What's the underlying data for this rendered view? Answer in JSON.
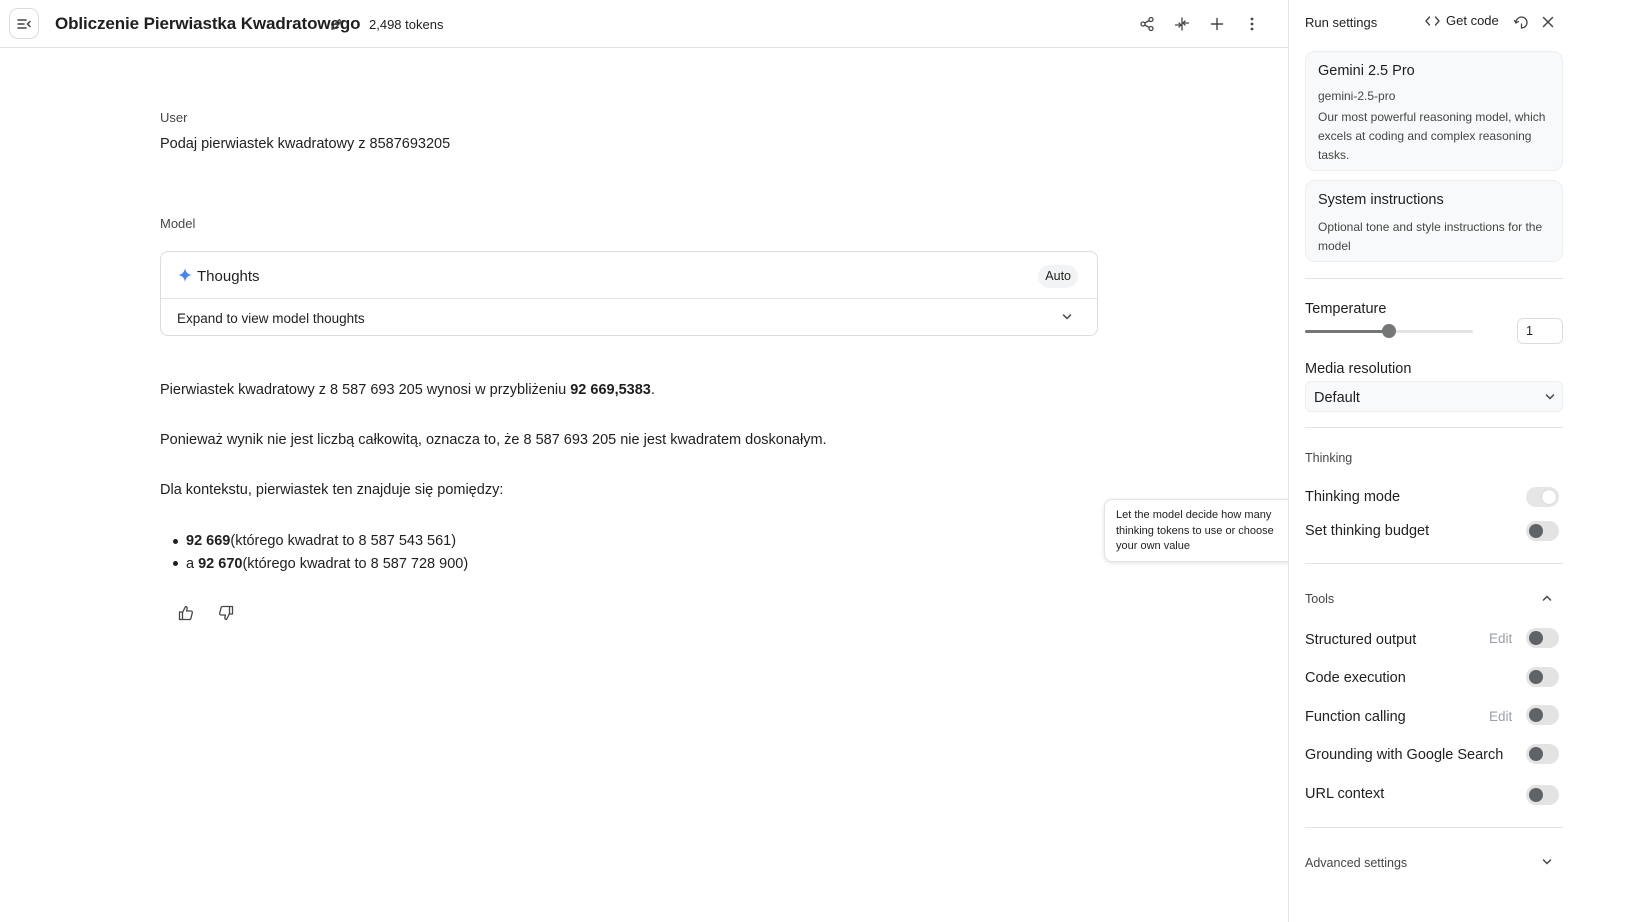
{
  "header": {
    "title": "Obliczenie Pierwiastka Kwadratowego",
    "tokens": "2,498 tokens"
  },
  "chat": {
    "user_label": "User",
    "user_message": "Podaj pierwiastek kwadratowy z 8587693205",
    "model_label": "Model",
    "thoughts": {
      "title": "Thoughts",
      "badge": "Auto",
      "expand_label": "Expand to view model thoughts"
    },
    "answer": {
      "p1_before": "Pierwiastek kwadratowy z 8 587 693 205 wynosi w przybliżeniu ",
      "p1_bold": "92 669,5383",
      "p1_after": ".",
      "p2": "Ponieważ wynik nie jest liczbą całkowitą, oznacza to, że 8 587 693 205 nie jest kwadratem doskonałym.",
      "p3": "Dla kontekstu, pierwiastek ten znajduje się pomiędzy:",
      "bullets": [
        {
          "prefix": "",
          "bold": "92 669",
          "rest": " (którego kwadrat to 8 587 543 561)"
        },
        {
          "prefix": "a ",
          "bold": "92 670",
          "rest": " (którego kwadrat to 8 587 728 900)"
        }
      ]
    }
  },
  "tooltip": {
    "text": "Let the model decide how many thinking tokens to use or choose your own value"
  },
  "run_settings": {
    "title": "Run settings",
    "get_code": "Get code",
    "model": {
      "name": "Gemini 2.5 Pro",
      "id": "gemini-2.5-pro",
      "description": "Our most powerful reasoning model, which excels at coding and complex reasoning tasks."
    },
    "system_instructions": {
      "title": "System instructions",
      "placeholder": "Optional tone and style instructions for the model"
    },
    "temperature": {
      "label": "Temperature",
      "value": "1",
      "fraction": 0.5
    },
    "media_resolution": {
      "label": "Media resolution",
      "value": "Default"
    },
    "thinking": {
      "section": "Thinking",
      "thinking_mode": "Thinking mode",
      "set_budget": "Set thinking budget"
    },
    "tools": {
      "section": "Tools",
      "structured_output": "Structured output",
      "code_execution": "Code execution",
      "function_calling": "Function calling",
      "grounding": "Grounding with Google Search",
      "url_context": "URL context",
      "edit_label": "Edit"
    },
    "advanced": "Advanced settings"
  },
  "colors": {
    "accent_spark": "#4285f4",
    "text": "#1f1f1f",
    "muted": "#444746",
    "border": "#dadce0"
  },
  "icons": [
    "menu-collapse-icon",
    "pencil-icon",
    "share-icon",
    "compare-icon",
    "plus-icon",
    "more-vert-icon",
    "spark-icon",
    "chevron-down-icon",
    "thumb-up-icon",
    "thumb-down-icon",
    "code-icon",
    "reset-icon",
    "close-icon",
    "chevron-up-icon"
  ]
}
